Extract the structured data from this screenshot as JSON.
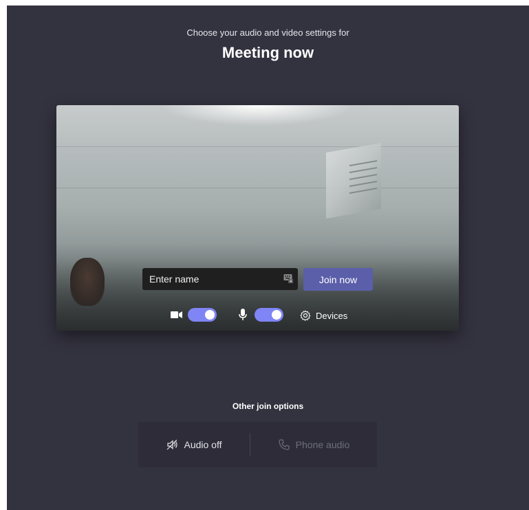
{
  "header": {
    "subtitle": "Choose your audio and video settings for",
    "title": "Meeting now"
  },
  "preview": {
    "name_input": {
      "placeholder": "Enter name",
      "value": ""
    },
    "keyboard_icon": "keyboard-icon",
    "join_button_label": "Join now",
    "video_toggle": {
      "icon": "camera-icon",
      "on": true
    },
    "audio_toggle": {
      "icon": "microphone-icon",
      "on": true
    },
    "devices_label": "Devices"
  },
  "other_options": {
    "label": "Other join options",
    "audio_off_label": "Audio off",
    "phone_audio_label": "Phone audio"
  },
  "colors": {
    "background": "#33323f",
    "accent": "#5b5fa9",
    "toggle_on": "#7f85f5",
    "options_panel": "#2d2c38"
  }
}
